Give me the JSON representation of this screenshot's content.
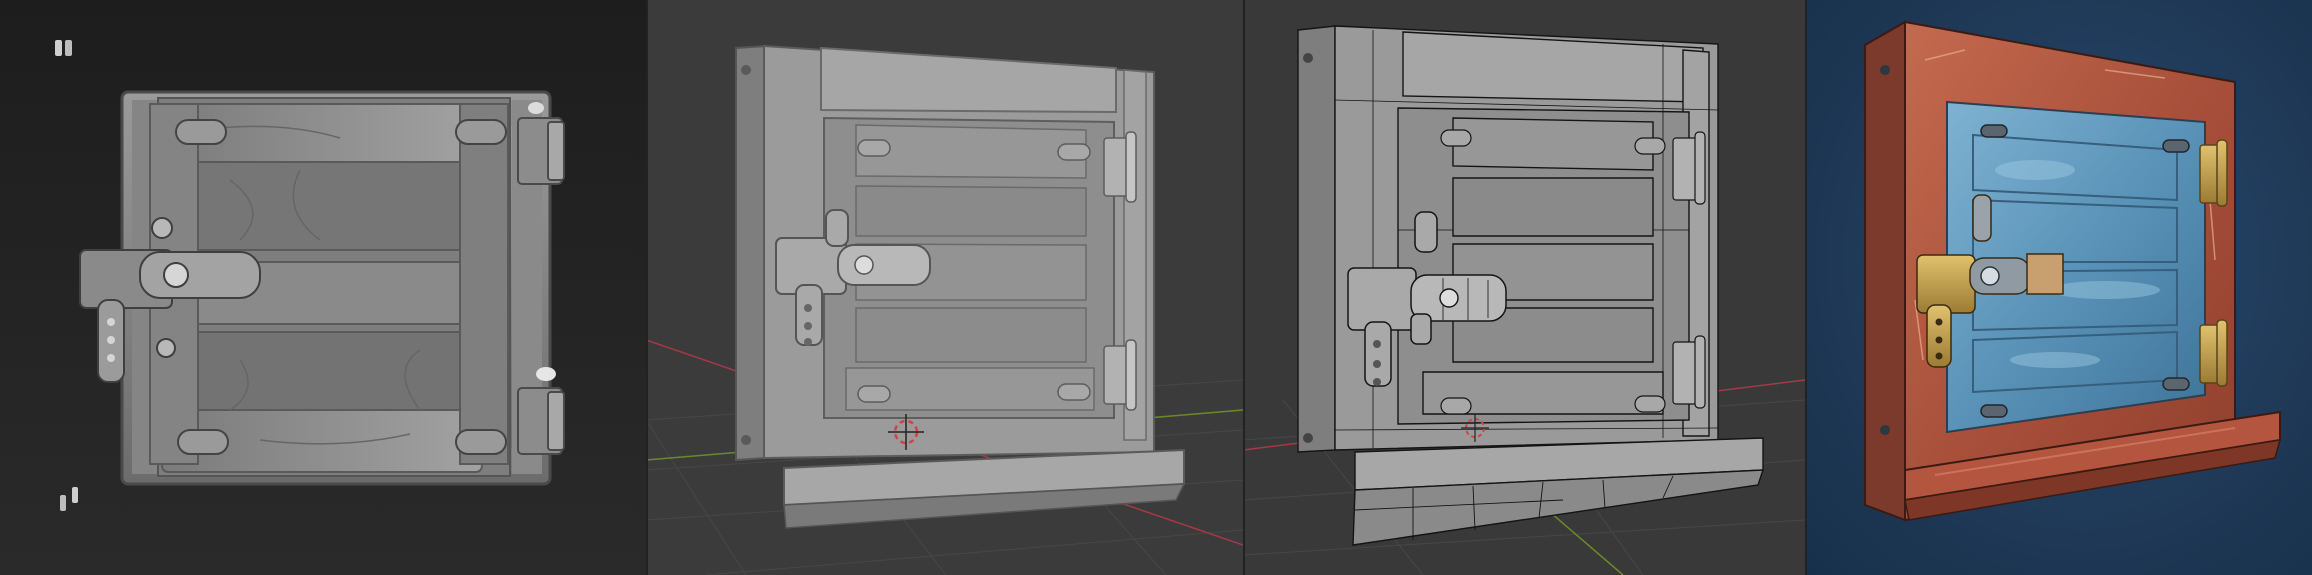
{
  "colors": {
    "sculpt_bg": "#222222",
    "viewport_bg": "#3b3b3b",
    "render_bg": "#1f3a5a",
    "clay": "#8a8a8a",
    "paint_frame": "#b5553f",
    "paint_door": "#5a93b8",
    "brass": "#b89a4a",
    "axis_red": "#a33a46",
    "axis_green": "#6a8a2a"
  },
  "panels": [
    {
      "id": "sculpt"
    },
    {
      "id": "lowpoly-clay"
    },
    {
      "id": "wireframe"
    },
    {
      "id": "painted-render"
    }
  ]
}
